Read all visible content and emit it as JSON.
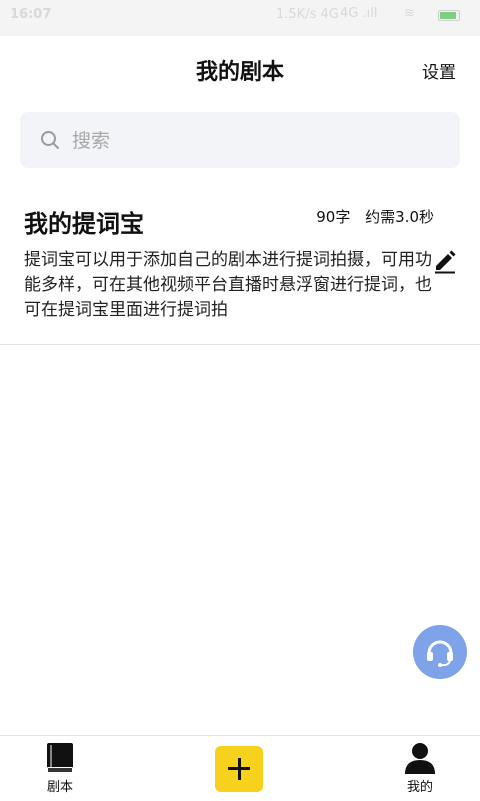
{
  "status_bar": {
    "time": "16:07",
    "network": "1.5K/s 4G",
    "signal": "4G .ıll",
    "wifi": "≋",
    "battery_level": 0.9
  },
  "header": {
    "title": "我的剧本",
    "settings_label": "设置"
  },
  "search": {
    "placeholder": "搜索",
    "value": ""
  },
  "scripts": [
    {
      "title": "我的提词宝",
      "word_count": "90字",
      "duration": "约需3.0秒",
      "description": "提词宝可以用于添加自己的剧本进行提词拍摄，可用功能多样，可在其他视频平台直播时悬浮窗进行提词，也可在提词宝里面进行提词拍"
    }
  ],
  "tabbar": {
    "scripts_label": "剧本",
    "mine_label": "我的"
  },
  "icons": {
    "search": "search-icon",
    "edit": "pencil-icon",
    "support": "headset-icon",
    "scripts": "book-icon",
    "add": "plus-icon",
    "mine": "person-icon"
  },
  "colors": {
    "accent": "#f7d21c",
    "support_button": "#7fa3e8",
    "search_bg": "#f3f4f8"
  }
}
